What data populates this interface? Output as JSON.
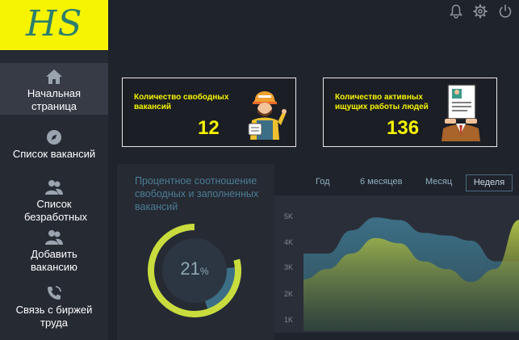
{
  "logo": {
    "text": "HS"
  },
  "topbar": {
    "icons": [
      "bell-icon",
      "gear-icon",
      "power-icon"
    ]
  },
  "sidebar": {
    "items": [
      {
        "label": "Начальная страница",
        "icon": "home-icon",
        "active": true
      },
      {
        "label": "Список вакансий",
        "icon": "compass-icon",
        "active": false
      },
      {
        "label": "Список безработных",
        "icon": "users-icon",
        "active": false
      },
      {
        "label": "Добавить вакансию",
        "icon": "users-icon",
        "active": false
      },
      {
        "label": "Связь с биржей труда",
        "icon": "phone-icon",
        "active": false
      }
    ]
  },
  "cards": [
    {
      "title": "Количество свободных вакансий",
      "value": "12",
      "illustration": "worker-illustration"
    },
    {
      "title": "Количество активных ищущих работы людей",
      "value": "136",
      "illustration": "resume-illustration"
    }
  ],
  "ratio": {
    "title": "Процентное соотношение свободных и заполненных вакансий",
    "percent_value": "21",
    "percent_sign": "%",
    "percent": 21
  },
  "tabs": [
    {
      "label": "Год",
      "active": false
    },
    {
      "label": "6 месяцев",
      "active": false
    },
    {
      "label": "Месяц",
      "active": false
    },
    {
      "label": "Неделя",
      "active": true
    }
  ],
  "chart_data": {
    "type": "area",
    "y_ticks": [
      "5K",
      "4K",
      "3K",
      "2K",
      "1K"
    ],
    "ylim": [
      1000,
      5000
    ],
    "series": [
      {
        "values": [
          3000,
          3000,
          3900,
          4400,
          4300,
          3800,
          3700,
          3500,
          2700,
          2700
        ]
      },
      {
        "values": [
          2000,
          2400,
          3000,
          3600,
          3400,
          2700,
          2400,
          1900,
          2400,
          4300
        ]
      }
    ]
  },
  "colors": {
    "yellow": "#f6f400",
    "teal": "#3c6f86",
    "lime": "#c8dc3e",
    "text_blue": "#4b7d94"
  }
}
